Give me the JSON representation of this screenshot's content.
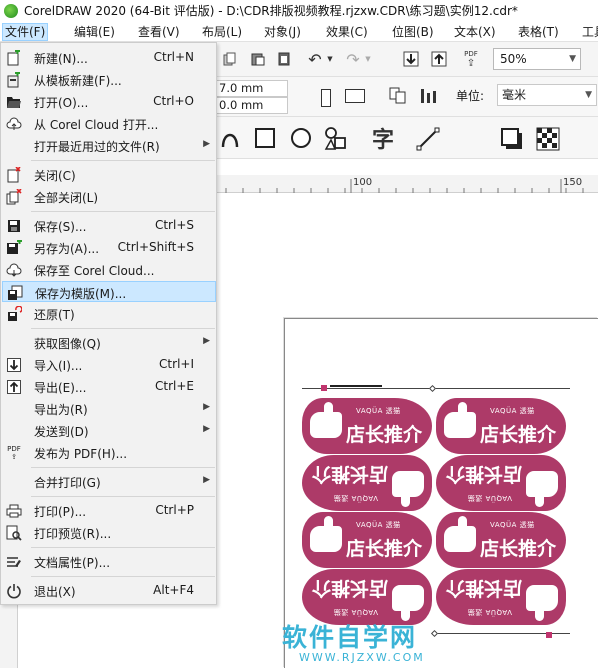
{
  "window": {
    "title": "CorelDRAW 2020 (64-Bit 评估版) - D:\\CDR排版视频教程.rjzxw.CDR\\练习题\\实例12.cdr*"
  },
  "menubar": {
    "items": [
      "文件(F)",
      "编辑(E)",
      "查看(V)",
      "布局(L)",
      "对象(J)",
      "效果(C)",
      "位图(B)",
      "文本(X)",
      "表格(T)",
      "工具"
    ]
  },
  "file_menu": {
    "items": [
      {
        "label": "新建(N)...",
        "shortcut": "Ctrl+N",
        "icon": "new-doc-icon"
      },
      {
        "label": "从模板新建(F)...",
        "shortcut": "",
        "icon": "template-new-icon"
      },
      {
        "label": "打开(O)...",
        "shortcut": "Ctrl+O",
        "icon": "folder-open-icon"
      },
      {
        "label": "从 Corel Cloud 打开...",
        "shortcut": "",
        "icon": "cloud-open-icon"
      },
      {
        "label": "打开最近用过的文件(R)",
        "shortcut": "",
        "icon": "",
        "submenu": true
      },
      {
        "label": "关闭(C)",
        "shortcut": "",
        "icon": "close-doc-icon"
      },
      {
        "label": "全部关闭(L)",
        "shortcut": "",
        "icon": "close-all-icon"
      },
      {
        "label": "保存(S)...",
        "shortcut": "Ctrl+S",
        "icon": "save-icon"
      },
      {
        "label": "另存为(A)...",
        "shortcut": "Ctrl+Shift+S",
        "icon": "save-as-icon"
      },
      {
        "label": "保存至 Corel Cloud...",
        "shortcut": "",
        "icon": "cloud-save-icon"
      },
      {
        "label": "保存为模版(M)...",
        "shortcut": "",
        "icon": "save-template-icon"
      },
      {
        "label": "还原(T)",
        "shortcut": "",
        "icon": "revert-icon"
      },
      {
        "label": "获取图像(Q)",
        "shortcut": "",
        "icon": "",
        "submenu": true
      },
      {
        "label": "导入(I)...",
        "shortcut": "Ctrl+I",
        "icon": "import-icon"
      },
      {
        "label": "导出(E)...",
        "shortcut": "Ctrl+E",
        "icon": "export-icon"
      },
      {
        "label": "导出为(R)",
        "shortcut": "",
        "icon": "",
        "submenu": true
      },
      {
        "label": "发送到(D)",
        "shortcut": "",
        "icon": "",
        "submenu": true
      },
      {
        "label": "发布为 PDF(H)...",
        "shortcut": "",
        "icon": "pdf-icon"
      },
      {
        "label": "合并打印(G)",
        "shortcut": "",
        "icon": "",
        "submenu": true
      },
      {
        "label": "打印(P)...",
        "shortcut": "Ctrl+P",
        "icon": "print-icon"
      },
      {
        "label": "打印预览(R)...",
        "shortcut": "",
        "icon": "print-preview-icon"
      },
      {
        "label": "文档属性(P)...",
        "shortcut": "",
        "icon": "doc-properties-icon"
      },
      {
        "label": "退出(X)",
        "shortcut": "Alt+F4",
        "icon": "exit-icon"
      }
    ]
  },
  "toolbar": {
    "zoom_value": "50%",
    "width_value": "7.0 mm",
    "height_value": "0.0 mm",
    "unit_label": "单位:",
    "unit_value": "毫米",
    "char_tool_glyph": "字",
    "pdf_label": "PDF"
  },
  "ruler": {
    "labels": [
      "100",
      "150"
    ]
  },
  "poster": {
    "brand": "VAQÜA 透猫",
    "slogan": "店长推介",
    "color": "#ad3a68"
  },
  "watermark": {
    "title": "软件自学网",
    "url": "WWW.RJZXW.COM"
  }
}
